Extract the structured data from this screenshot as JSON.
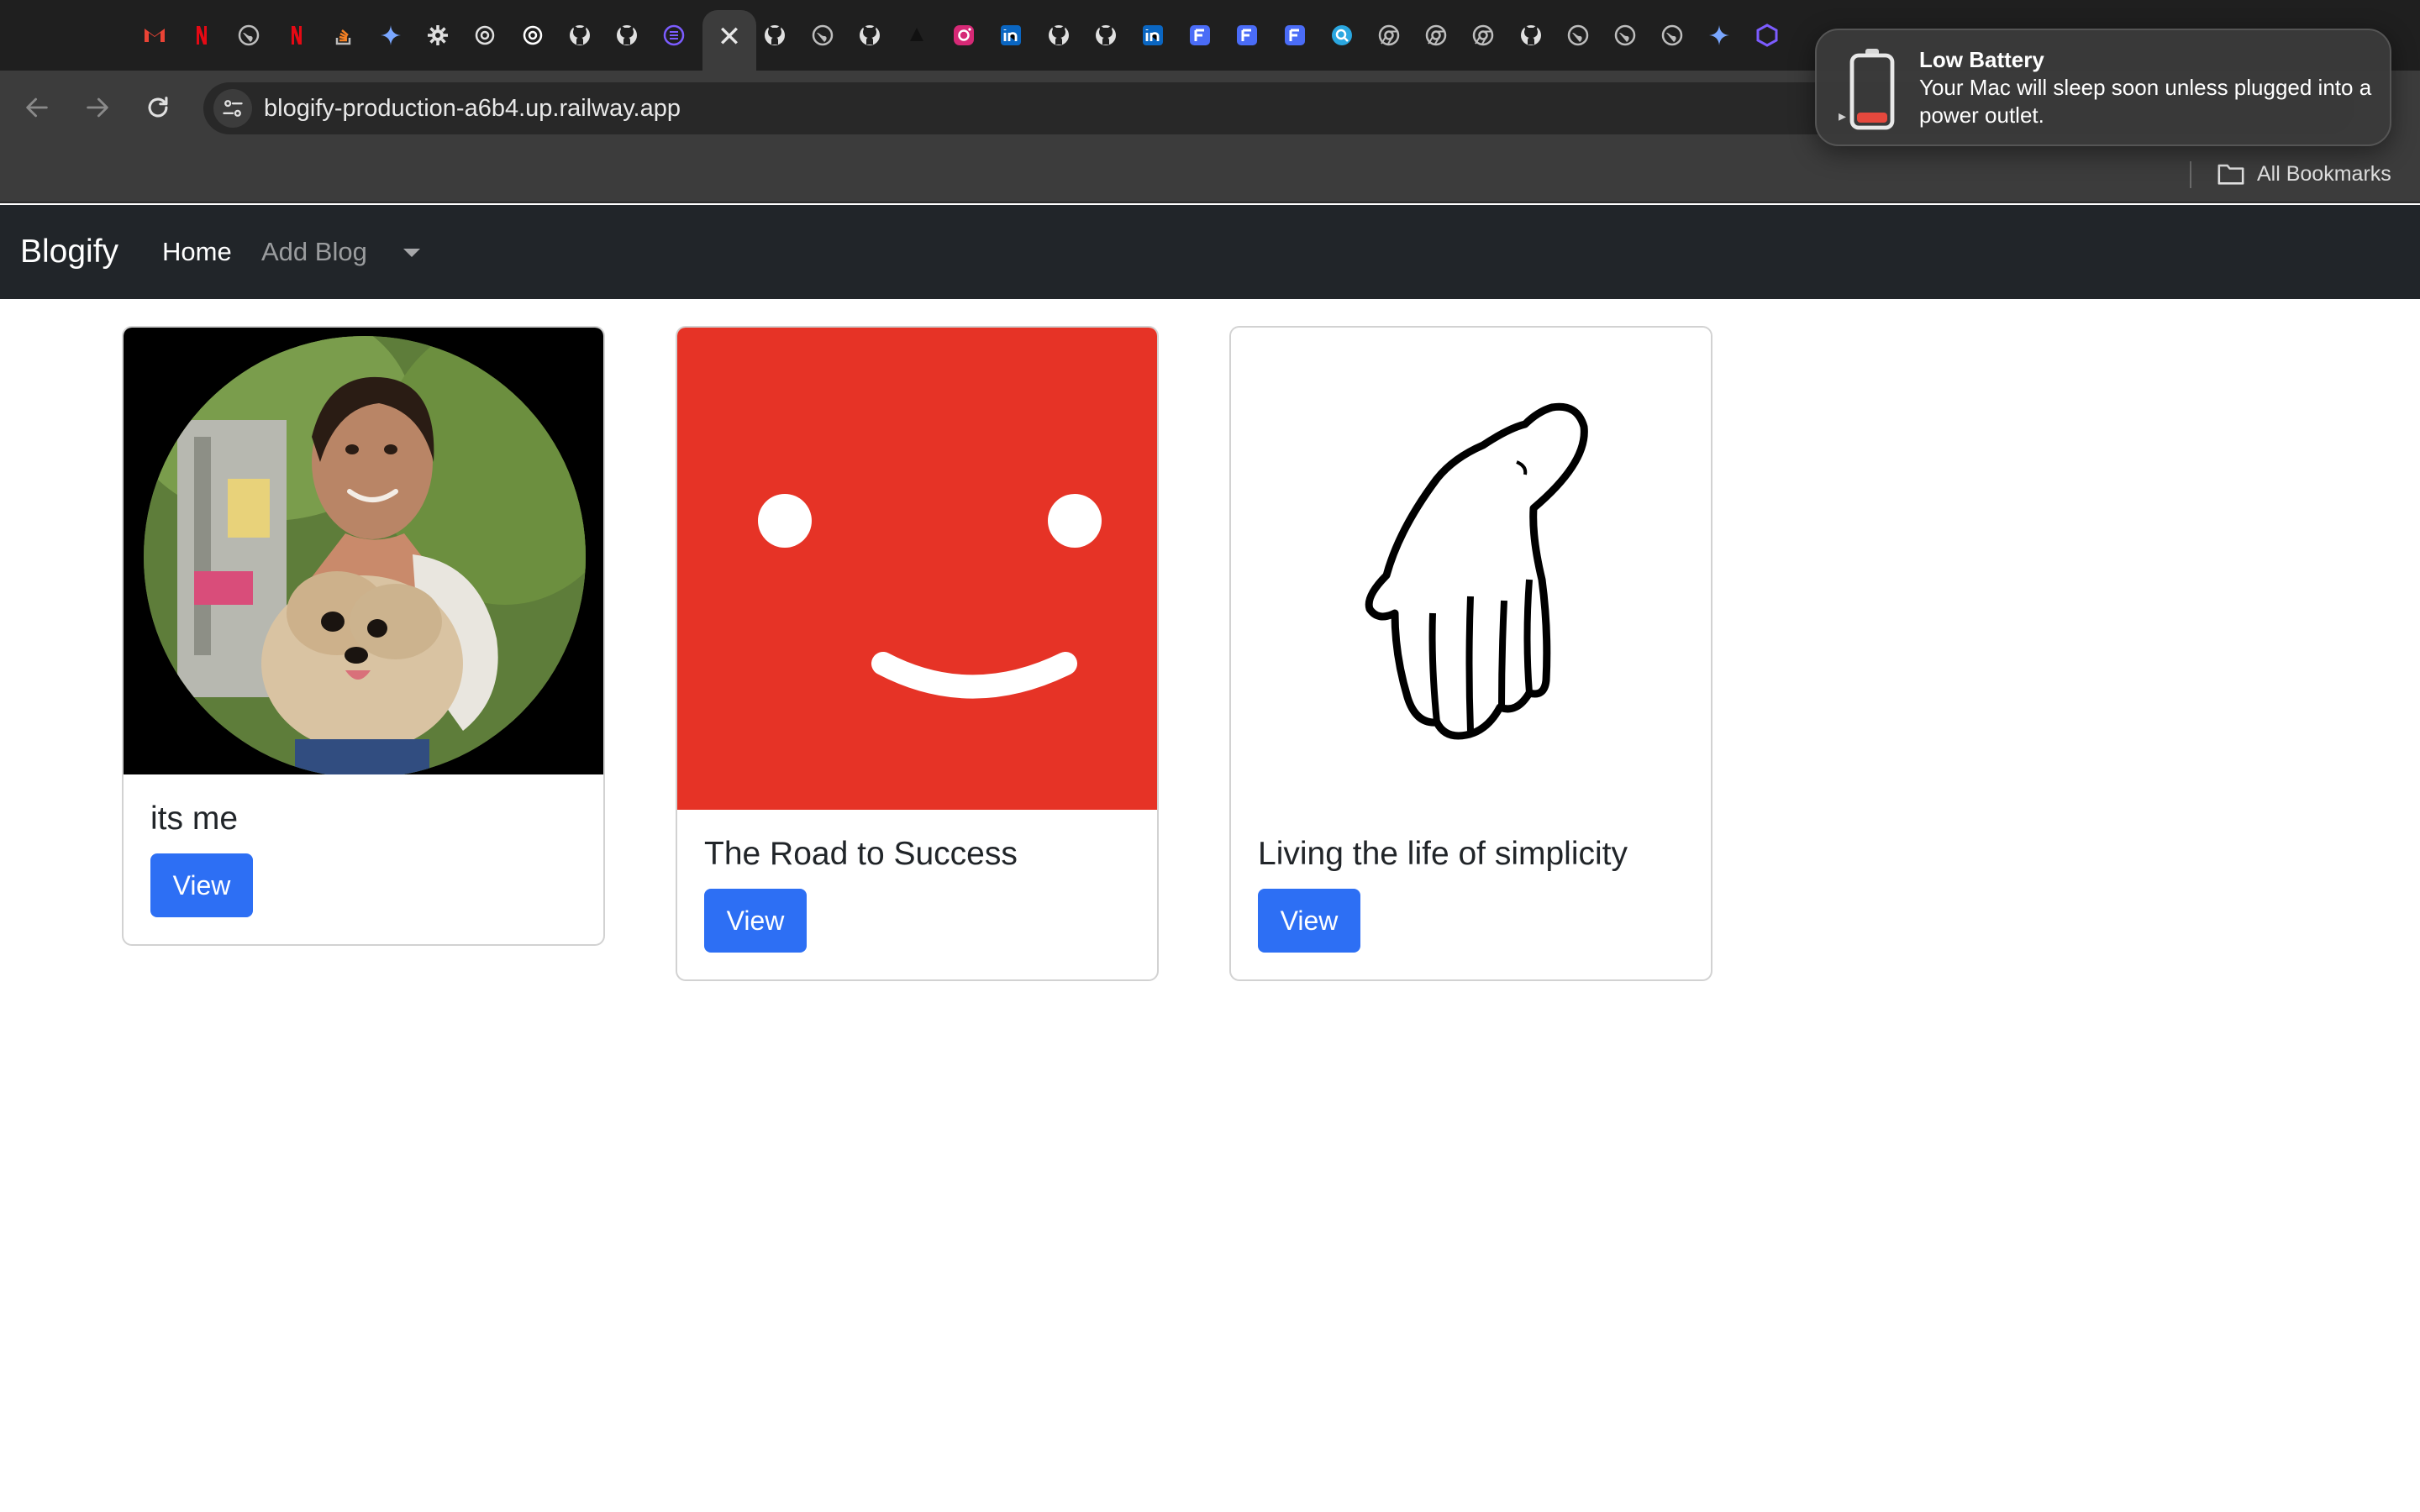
{
  "browser": {
    "tab_icons": [
      {
        "name": "gmail-icon",
        "color": "#ea4335"
      },
      {
        "name": "netflix-icon",
        "color": "#e50914"
      },
      {
        "name": "globe-icon",
        "color": "#bdbdbd"
      },
      {
        "name": "netflix-icon",
        "color": "#e50914"
      },
      {
        "name": "stackoverflow-icon",
        "color": "#f48024"
      },
      {
        "name": "gemini-icon",
        "color": "#7aa7ff"
      },
      {
        "name": "gear-icon",
        "color": "#e0e0e0"
      },
      {
        "name": "chatgpt-icon",
        "color": "#e0e0e0"
      },
      {
        "name": "chatgpt-icon",
        "color": "#ffffff"
      },
      {
        "name": "github-icon",
        "color": "#e0e0e0"
      },
      {
        "name": "github-icon",
        "color": "#e0e0e0"
      },
      {
        "name": "brain-icon",
        "color": "#7c5cff"
      },
      {
        "name": "github-icon",
        "color": "#e0e0e0"
      },
      {
        "name": "globe-icon",
        "color": "#bdbdbd"
      },
      {
        "name": "github-icon",
        "color": "#e0e0e0"
      },
      {
        "name": "triangle-icon",
        "color": "#111111"
      },
      {
        "name": "instagram-icon",
        "color": "#d62976"
      },
      {
        "name": "linkedin-icon",
        "color": "#0a66c2"
      },
      {
        "name": "github-icon",
        "color": "#e0e0e0"
      },
      {
        "name": "github-icon",
        "color": "#e0e0e0"
      },
      {
        "name": "linkedin-icon",
        "color": "#0a66c2"
      },
      {
        "name": "forms-icon",
        "color": "#4a6cf7"
      },
      {
        "name": "forms-icon",
        "color": "#4a6cf7"
      },
      {
        "name": "forms-icon",
        "color": "#4a6cf7"
      },
      {
        "name": "search-app-icon",
        "color": "#2aa7e0"
      },
      {
        "name": "chrome-icon",
        "color": "#bdbdbd"
      },
      {
        "name": "chrome-icon",
        "color": "#bdbdbd"
      },
      {
        "name": "chrome-icon",
        "color": "#bdbdbd"
      },
      {
        "name": "github-icon",
        "color": "#e0e0e0"
      },
      {
        "name": "globe-icon",
        "color": "#bdbdbd"
      },
      {
        "name": "globe-icon",
        "color": "#bdbdbd"
      },
      {
        "name": "globe-icon",
        "color": "#bdbdbd"
      },
      {
        "name": "gemini-icon",
        "color": "#7aa7ff"
      },
      {
        "name": "hexagon-icon",
        "color": "#7c5cff"
      }
    ],
    "active_tab_close": "✕",
    "url": "blogify-production-a6b4.up.railway.app",
    "bookmarks_label": "All Bookmarks"
  },
  "notification": {
    "title": "Low Battery",
    "body": "Your Mac will sleep soon unless plugged into a power outlet.",
    "battery_color": "#e5483d"
  },
  "navbar": {
    "brand": "Blogify",
    "home": "Home",
    "add_blog": "Add Blog"
  },
  "cards": [
    {
      "title": "its me",
      "button": "View",
      "image": "portrait-photo"
    },
    {
      "title": "The Road to Success",
      "button": "View",
      "image": "smiley-face-red",
      "image_color": "#e63326"
    },
    {
      "title": "Living the life of simplicity",
      "button": "View",
      "image": "hand-sketch"
    }
  ],
  "colors": {
    "navbar_bg": "#212529",
    "button_bg": "#2d6ff4",
    "browser_bg": "#1f1f1f"
  }
}
